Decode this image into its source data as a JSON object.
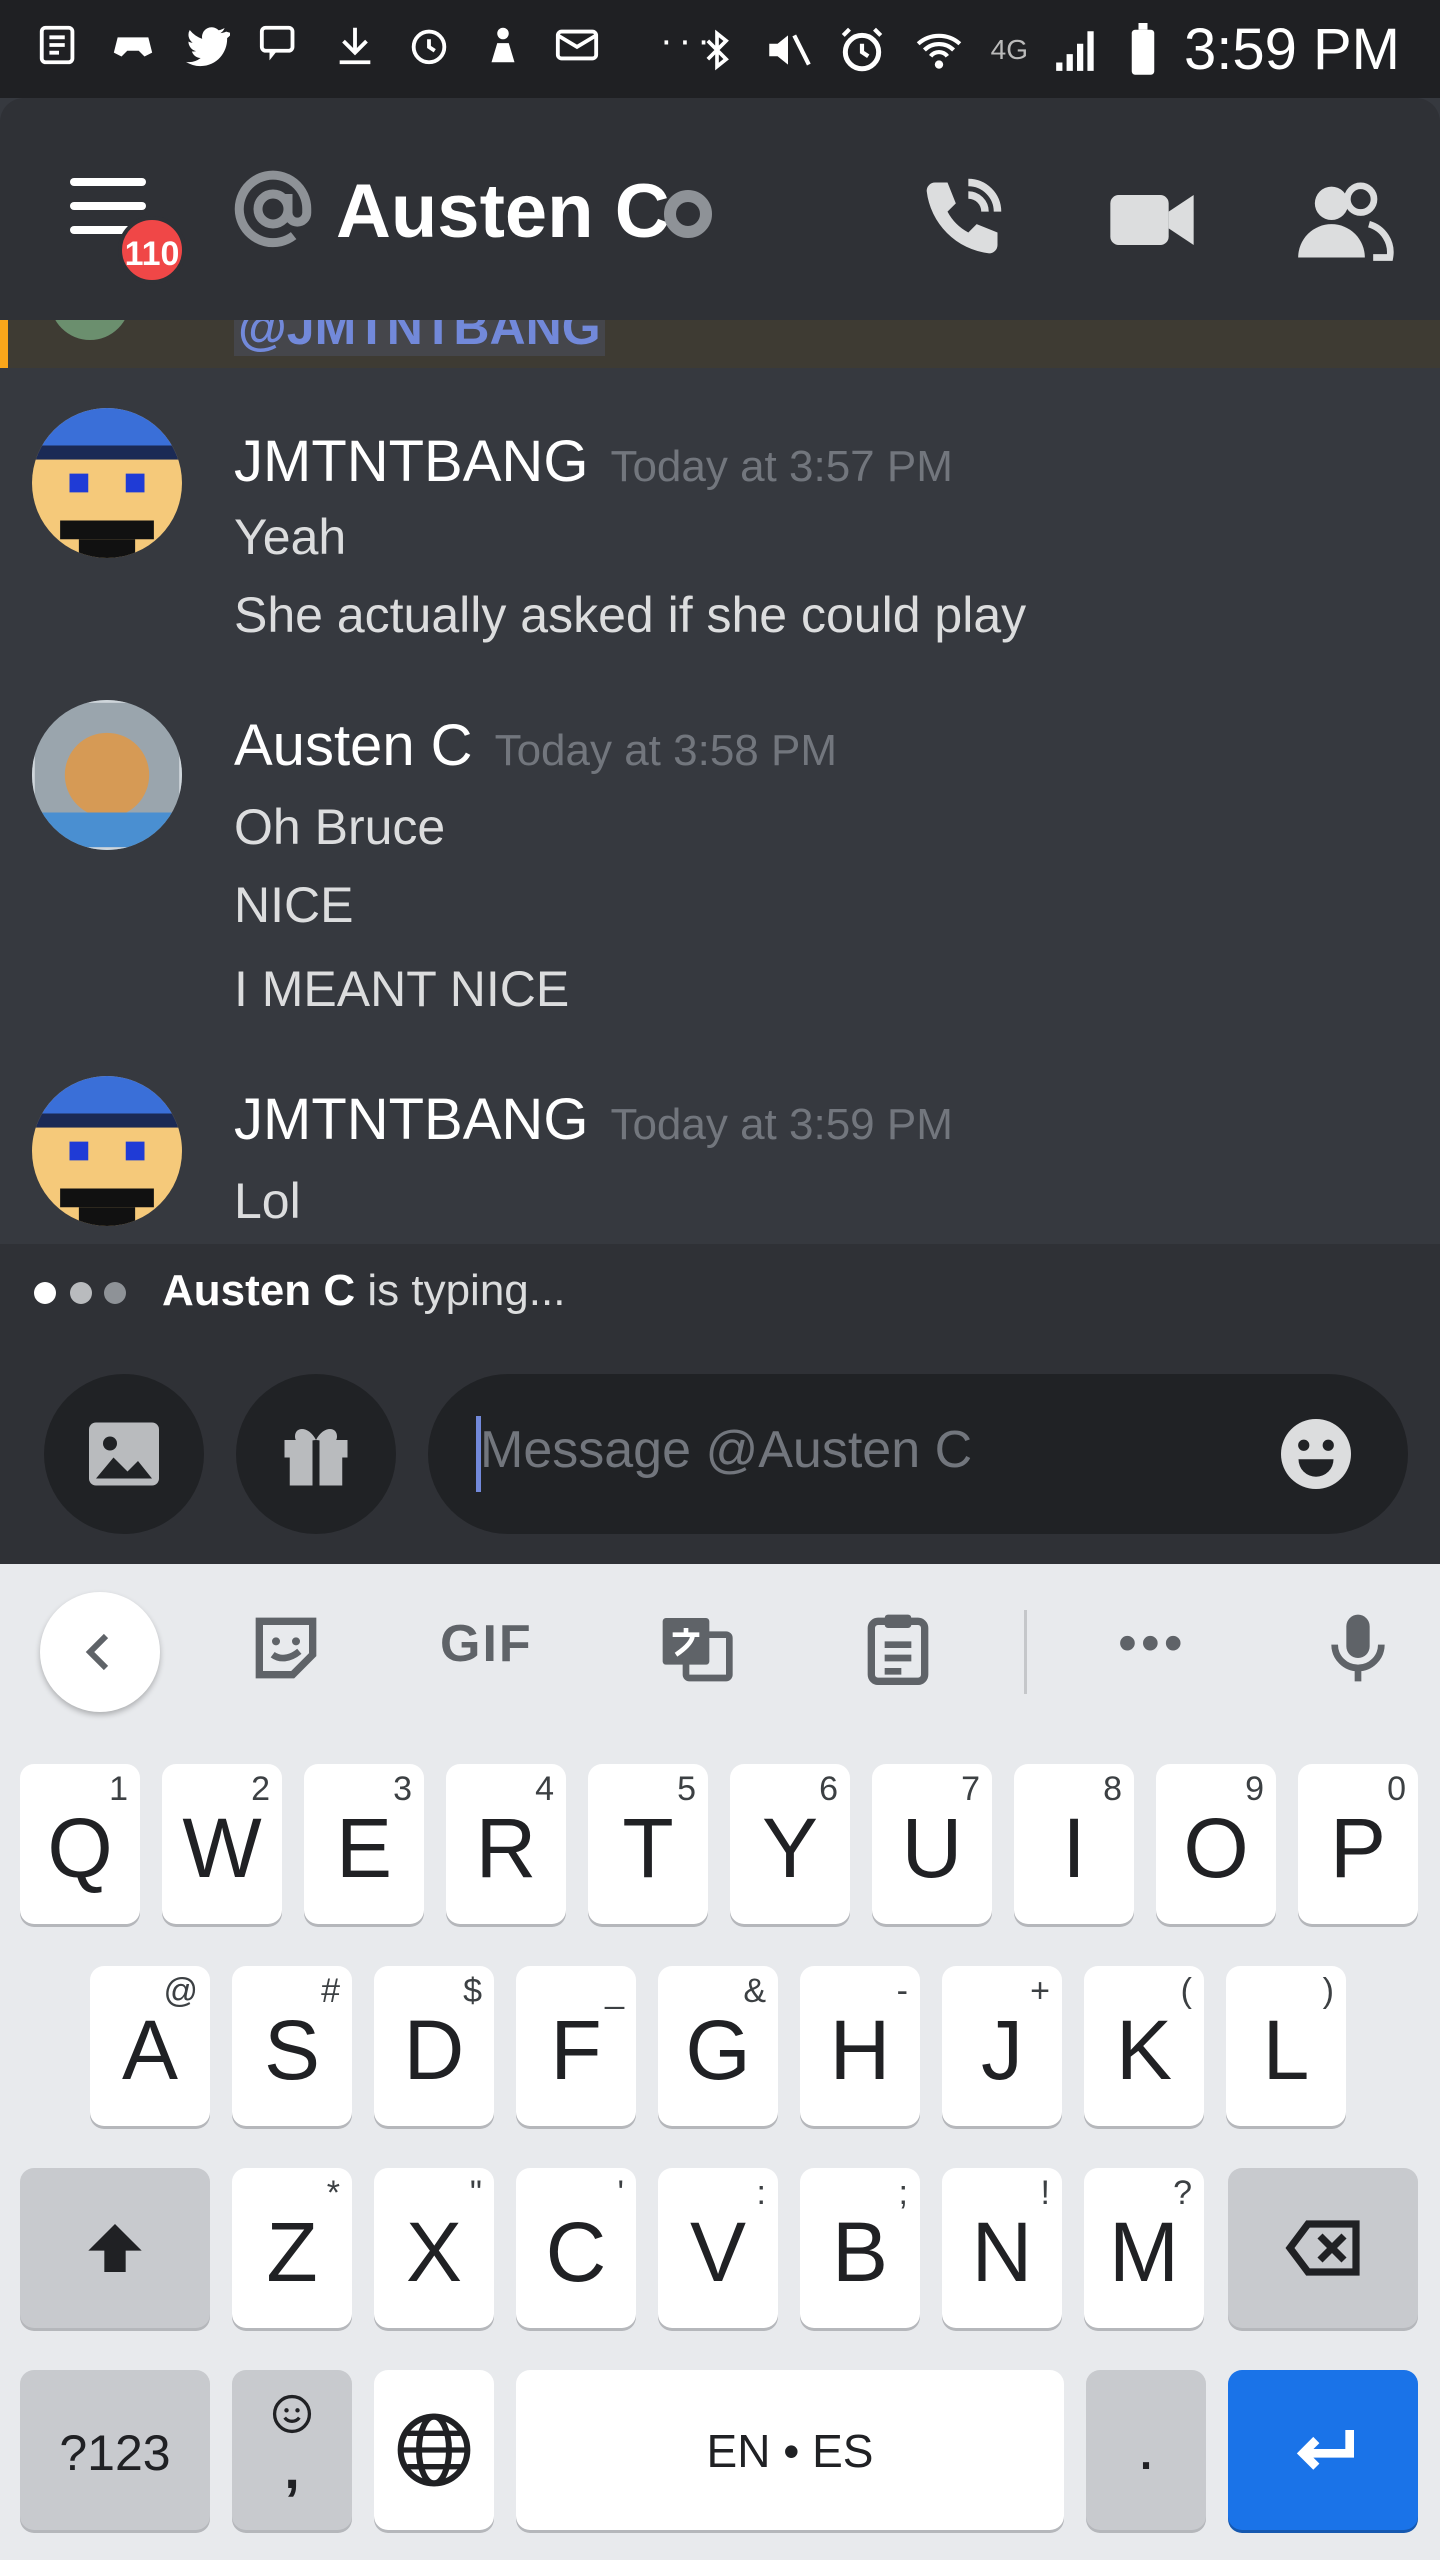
{
  "status_bar": {
    "time": "3:59 PM",
    "network": "4G",
    "notification_icons": [
      "news-icon",
      "game-controller-icon",
      "twitter-icon",
      "chat-icon",
      "download-icon",
      "timer-icon",
      "person-icon",
      "mail-icon"
    ],
    "overflow": "···"
  },
  "header": {
    "title": "Austen C",
    "unread_badge": "110",
    "buttons": [
      "phone-icon",
      "video-icon",
      "members-icon"
    ]
  },
  "messages": {
    "mention_partial": "@JMTNTBANG",
    "groups": [
      {
        "author": "JMTNTBANG",
        "timestamp": "Today at 3:57 PM",
        "lines": [
          "Yeah",
          "She actually asked if she could play"
        ]
      },
      {
        "author": "Austen C",
        "timestamp": "Today at 3:58 PM",
        "lines": [
          "Oh Bruce",
          "NICE",
          "I MEANT NICE"
        ]
      },
      {
        "author": "JMTNTBANG",
        "timestamp": "Today at 3:59 PM",
        "lines": [
          "Lol"
        ]
      }
    ]
  },
  "typing": {
    "user": "Austen C",
    "suffix": " is typing..."
  },
  "composer": {
    "placeholder": "Message @Austen C"
  },
  "keyboard": {
    "toolbar": {
      "gif": "GIF",
      "more": "•••"
    },
    "row1": [
      {
        "k": "Q",
        "h": "1"
      },
      {
        "k": "W",
        "h": "2"
      },
      {
        "k": "E",
        "h": "3"
      },
      {
        "k": "R",
        "h": "4"
      },
      {
        "k": "T",
        "h": "5"
      },
      {
        "k": "Y",
        "h": "6"
      },
      {
        "k": "U",
        "h": "7"
      },
      {
        "k": "I",
        "h": "8"
      },
      {
        "k": "O",
        "h": "9"
      },
      {
        "k": "P",
        "h": "0"
      }
    ],
    "row2": [
      {
        "k": "A",
        "h": "@"
      },
      {
        "k": "S",
        "h": "#"
      },
      {
        "k": "D",
        "h": "$"
      },
      {
        "k": "F",
        "h": "_"
      },
      {
        "k": "G",
        "h": "&"
      },
      {
        "k": "H",
        "h": "-"
      },
      {
        "k": "J",
        "h": "+"
      },
      {
        "k": "K",
        "h": "("
      },
      {
        "k": "L",
        "h": ")"
      }
    ],
    "row3": [
      {
        "k": "Z",
        "h": "*"
      },
      {
        "k": "X",
        "h": "\""
      },
      {
        "k": "C",
        "h": "'"
      },
      {
        "k": "V",
        "h": ":"
      },
      {
        "k": "B",
        "h": ";"
      },
      {
        "k": "N",
        "h": "!"
      },
      {
        "k": "M",
        "h": "?"
      }
    ],
    "symbols_key": "?123",
    "comma_key": ",",
    "space_key": "EN • ES",
    "period_key": "."
  },
  "colors": {
    "chat_bg": "#36393f",
    "header_bg": "#2f3136",
    "badge": "#f04747",
    "mention": "#7289da",
    "enter_key": "#1a73e8"
  }
}
